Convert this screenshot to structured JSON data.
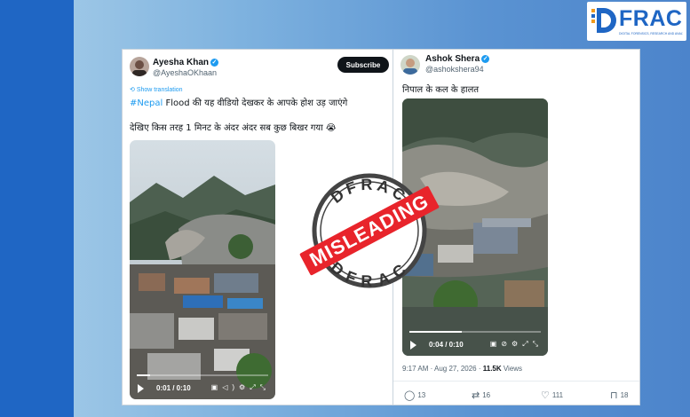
{
  "logo": {
    "text": "FRAC",
    "letter": "D",
    "tagline": "DIGITAL FORENSICS, RESEARCH AND ANALYTICS CENTRE"
  },
  "stamp": {
    "top_text": "DFRAC",
    "label": "MISLEADING",
    "bottom_text": "DFRAC"
  },
  "colors": {
    "brand_blue": "#1f66c4",
    "stamp_red": "#e8242b",
    "link_blue": "#1d9bf0"
  },
  "left_tweet": {
    "name": "Ayesha Khan",
    "handle": "@AyeshaOKhaan",
    "subscribe_label": "Subscribe",
    "show_translation": "Show translation",
    "hashtag": "#Nepal",
    "line1": " Flood की यह वीडियो देखकर के आपके होश उड़ जाएंगे",
    "line2": "देखिए किस तरह 1 मिनट के अंदर अंदर सब कुछ बिखर गया 😭",
    "video": {
      "time": "0:01 / 0:10",
      "progress": 0.1
    }
  },
  "right_tweet": {
    "name": "Ashok Shera",
    "handle": "@ashokshera94",
    "text": "निपाल के कल के हालत",
    "video": {
      "time": "0:04 / 0:10",
      "progress": 0.4
    },
    "timestamp": "9:17 AM · Aug 27, 2026 · ",
    "views_count": "11.5K",
    "views_label": " Views",
    "actions": {
      "replies": "13",
      "reposts": "16",
      "likes": "111",
      "bookmarks": "18"
    }
  }
}
